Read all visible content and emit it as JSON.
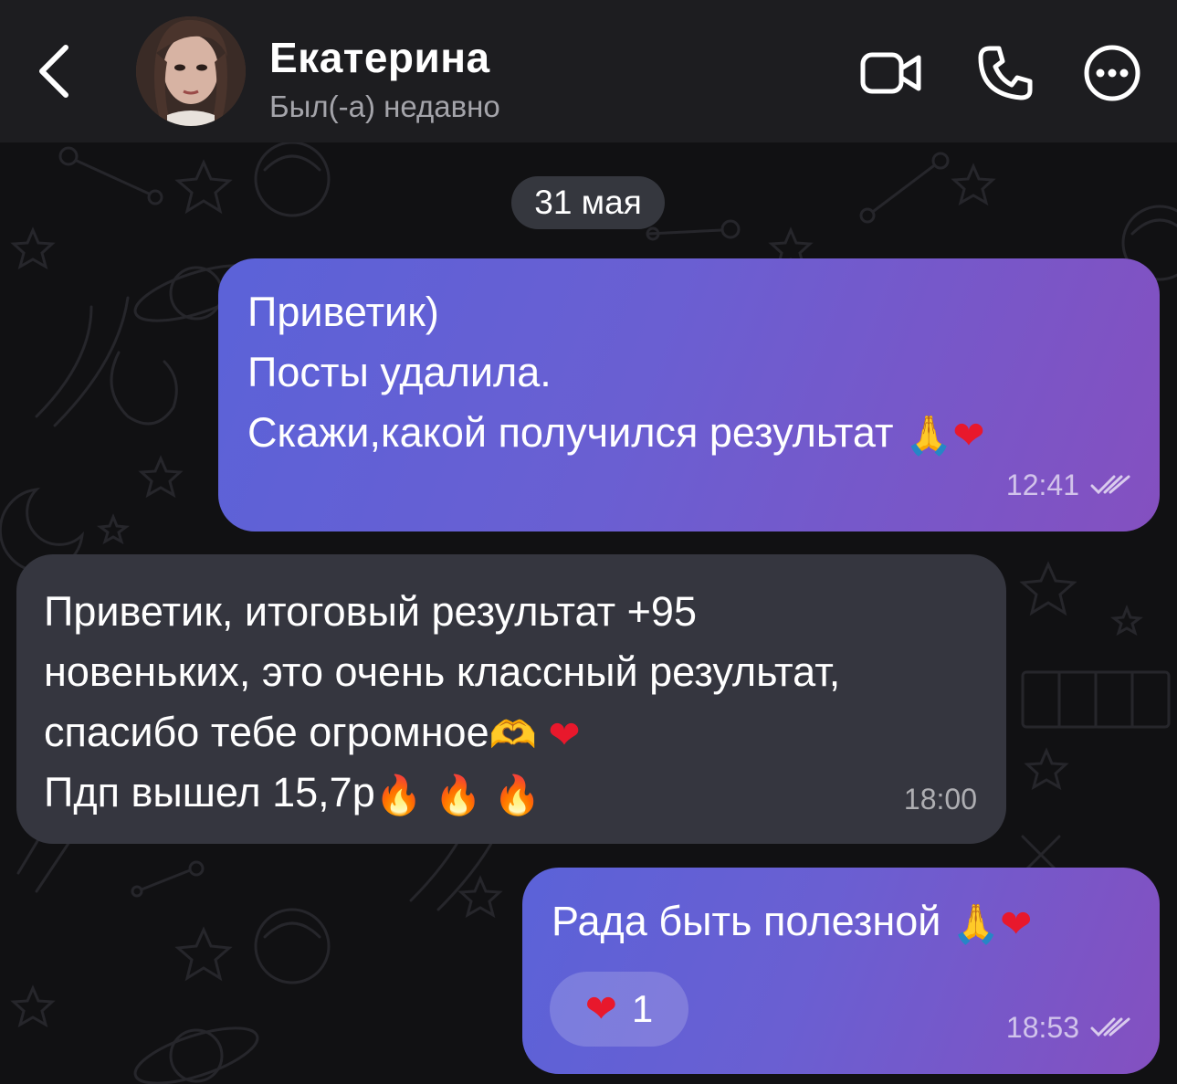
{
  "header": {
    "back_icon": "chevron-left-icon",
    "contact_name": "Екатерина",
    "status": "Был(-а) недавно",
    "icons": [
      "video-camera-icon",
      "phone-icon",
      "more-options-icon"
    ]
  },
  "date_separator": "31 мая",
  "messages": [
    {
      "direction": "outgoing",
      "lines": [
        "Приветик)",
        "Посты удалила.",
        "Скажи,какой получился результат "
      ],
      "emoji_tail": [
        "🙏",
        "❤"
      ],
      "time": "12:41",
      "read_icon": "double-check-icon"
    },
    {
      "direction": "incoming",
      "lines": [
        "Приветик, итоговый результат +95",
        "новеньких, это очень классный результат,",
        "спасибо тебе огромное",
        "Пдп вышел 15,7р"
      ],
      "line3_emoji": [
        "🫶",
        "❤"
      ],
      "line4_emoji": [
        "🔥",
        "🔥",
        "🔥"
      ],
      "time": "18:00"
    },
    {
      "direction": "outgoing",
      "lines": [
        "Рада быть полезной "
      ],
      "emoji_tail": [
        "🙏",
        "❤"
      ],
      "reaction": {
        "emoji": "❤",
        "count": "1"
      },
      "time": "18:53",
      "read_icon": "double-check-icon"
    }
  ],
  "colors": {
    "header_bg": "#1d1d20",
    "chat_bg": "#111113",
    "outgoing_gradient_start": "#5b62d8",
    "outgoing_gradient_end": "#8450c0",
    "incoming_bg": "#35363f"
  }
}
